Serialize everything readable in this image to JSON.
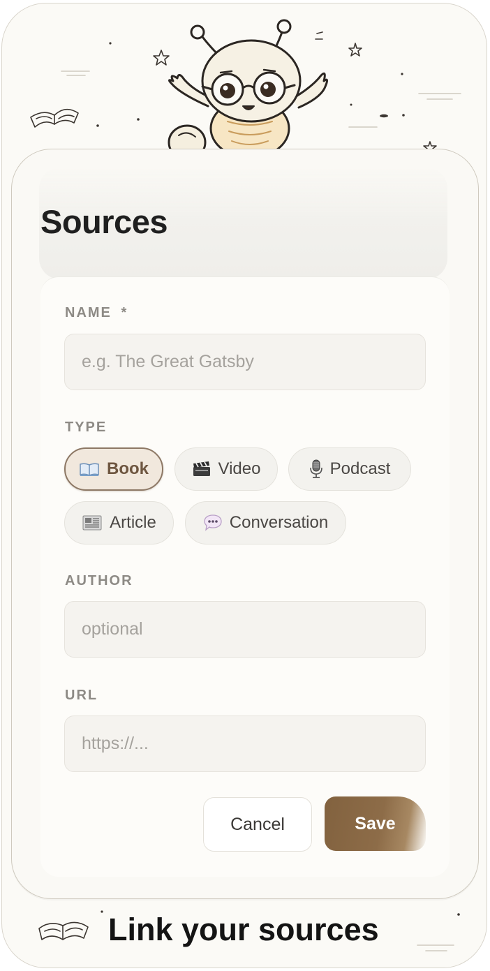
{
  "header": {
    "title": "Sources"
  },
  "form": {
    "name": {
      "label": "NAME",
      "required_mark": "*",
      "placeholder": "e.g. The Great Gatsby",
      "value": ""
    },
    "type": {
      "label": "TYPE",
      "selected": "Book",
      "options": [
        {
          "label": "Book",
          "icon": "book-icon",
          "glyph": "📖"
        },
        {
          "label": "Video",
          "icon": "clapperboard-icon",
          "glyph": "🎬"
        },
        {
          "label": "Podcast",
          "icon": "microphone-icon",
          "glyph": "🎙"
        },
        {
          "label": "Article",
          "icon": "newspaper-icon",
          "glyph": "📰"
        },
        {
          "label": "Conversation",
          "icon": "speech-bubble-icon",
          "glyph": "💬"
        }
      ]
    },
    "author": {
      "label": "AUTHOR",
      "placeholder": "optional",
      "value": ""
    },
    "url": {
      "label": "URL",
      "placeholder": "https://...",
      "value": ""
    }
  },
  "actions": {
    "cancel_label": "Cancel",
    "save_label": "Save"
  },
  "footer": {
    "caption": "Link your sources"
  },
  "colors": {
    "background": "#fbfaf6",
    "accent": "#82623f",
    "chip_selected_bg": "#f1e8dd",
    "chip_selected_border": "#8d7865",
    "input_bg": "#f5f3ef",
    "label": "#8d8a85"
  }
}
